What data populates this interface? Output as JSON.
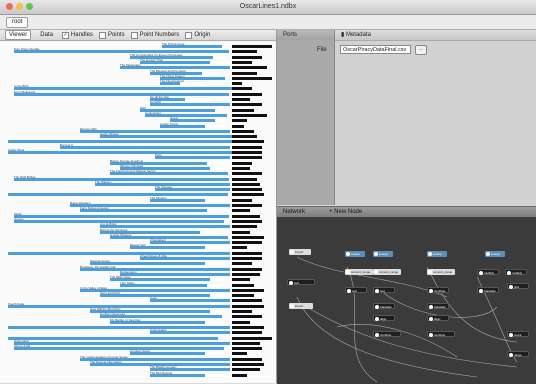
{
  "window": {
    "title": "OscarLines1.ndbx",
    "lights": [
      "#ec6a5e",
      "#f4bf4f",
      "#61c554"
    ]
  },
  "toolbar": {
    "button": "root"
  },
  "viewer": {
    "tabs": [
      "Viewer",
      "Data"
    ],
    "checks": [
      {
        "label": "Handles",
        "checked": true
      },
      {
        "label": "Points",
        "checked": false
      },
      {
        "label": "Point Numbers",
        "checked": false
      },
      {
        "label": "Origin",
        "checked": false
      }
    ],
    "rows": [
      {
        "label": "The Prince Kong",
        "bl": 162,
        "bw": 60,
        "ww": 0,
        "kw": 40
      },
      {
        "label": "Pom Poms Sunday",
        "bl": 14,
        "bw": 215,
        "ww": 0,
        "kw": 25
      },
      {
        "label": "The Complexities of Unseen Processes",
        "bl": 130,
        "bw": 95,
        "ww": 12,
        "kw": 30
      },
      {
        "label": "The Honest Thief",
        "bl": 140,
        "bw": 90,
        "ww": 20,
        "kw": 20
      },
      {
        "label": "The Messenger",
        "bl": 120,
        "bw": 110,
        "ww": 0,
        "kw": 35
      },
      {
        "label": "The Blessed and the Dead",
        "bl": 150,
        "bw": 70,
        "ww": 18,
        "kw": 25
      },
      {
        "label": "The Flying Dragon",
        "bl": 160,
        "bw": 65,
        "ww": 0,
        "kw": 40
      },
      {
        "label": "The Final Festival",
        "bl": 160,
        "bw": 45,
        "ww": 25,
        "kw": 10
      },
      {
        "label": "In the Birth",
        "bl": 14,
        "bw": 220,
        "ww": 0,
        "kw": 20
      },
      {
        "label": "Harry Bellefonte",
        "bl": 14,
        "bw": 215,
        "ww": 0,
        "kw": 30
      },
      {
        "label": "On all the Day",
        "bl": 150,
        "bw": 60,
        "ww": 25,
        "kw": 18
      },
      {
        "label": "Gentrific",
        "bl": 150,
        "bw": 80,
        "ww": 0,
        "kw": 30
      },
      {
        "label": "Well",
        "bl": 140,
        "bw": 75,
        "ww": 0,
        "kw": 22
      },
      {
        "label": "Conjunction",
        "bl": 145,
        "bw": 82,
        "ww": 0,
        "kw": 35
      },
      {
        "label": "Guest",
        "bl": 170,
        "bw": 55,
        "ww": 10,
        "kw": 15
      },
      {
        "label": "Lonely Towns",
        "bl": 160,
        "bw": 65,
        "ww": 20,
        "kw": 12
      },
      {
        "label": "Elusive Gifts",
        "bl": 80,
        "bw": 150,
        "ww": 0,
        "kw": 22
      },
      {
        "label": "Happy Bolivar",
        "bl": 100,
        "bw": 132,
        "ww": 0,
        "kw": 25
      },
      {
        "label": "",
        "bl": 8,
        "bw": 225,
        "ww": 0,
        "kw": 32
      },
      {
        "label": "Burning 9",
        "bl": 60,
        "bw": 170,
        "ww": 0,
        "kw": 30
      },
      {
        "label": "Inside Attica",
        "bl": 8,
        "bw": 225,
        "ww": 0,
        "kw": 30
      },
      {
        "label": "Paris",
        "bl": 155,
        "bw": 75,
        "ww": 0,
        "kw": 30
      },
      {
        "label": "Before Sunrise Amethyst",
        "bl": 110,
        "bw": 115,
        "ww": 18,
        "kw": 20
      },
      {
        "label": "Silence Unlimited",
        "bl": 120,
        "bw": 110,
        "ww": 20,
        "kw": 18
      },
      {
        "label": "The Fourth Kind of Darkest Secret",
        "bl": 110,
        "bw": 118,
        "ww": 0,
        "kw": 30
      },
      {
        "label": "The Wolf Bridge",
        "bl": 14,
        "bw": 215,
        "ww": 0,
        "kw": 25
      },
      {
        "label": "The Warden",
        "bl": 95,
        "bw": 135,
        "ww": 0,
        "kw": 28
      },
      {
        "label": "The Odyssey",
        "bl": 155,
        "bw": 75,
        "ww": 0,
        "kw": 30
      },
      {
        "label": "",
        "bl": 8,
        "bw": 220,
        "ww": 0,
        "kw": 32
      },
      {
        "label": "The Minstrel",
        "bl": 150,
        "bw": 75,
        "ww": 20,
        "kw": 20
      },
      {
        "label": "Bugsy Dandam",
        "bl": 70,
        "bw": 160,
        "ww": 0,
        "kw": 30
      },
      {
        "label": "Forty Sixties Ancestor",
        "bl": 80,
        "bw": 145,
        "ww": 18,
        "kw": 18
      },
      {
        "label": "Melior",
        "bl": 14,
        "bw": 215,
        "ww": 0,
        "kw": 28
      },
      {
        "label": "Joyous",
        "bl": 14,
        "bw": 210,
        "ww": 0,
        "kw": 30
      },
      {
        "label": "A to la Ricks",
        "bl": 100,
        "bw": 130,
        "ww": 0,
        "kw": 25
      },
      {
        "label": "Behind the Windows",
        "bl": 100,
        "bw": 120,
        "ww": 20,
        "kw": 18
      },
      {
        "label": "Amulet Wrapper",
        "bl": 110,
        "bw": 118,
        "ww": 0,
        "kw": 32
      },
      {
        "label": "Chandeliers",
        "bl": 150,
        "bw": 80,
        "ww": 0,
        "kw": 30
      },
      {
        "label": "Beaver Doll",
        "bl": 130,
        "bw": 95,
        "ww": 20,
        "kw": 15
      },
      {
        "label": "",
        "bl": 8,
        "bw": 222,
        "ww": 0,
        "kw": 30
      },
      {
        "label": "Cheerfulness & May",
        "bl": 140,
        "bw": 90,
        "ww": 0,
        "kw": 30
      },
      {
        "label": "Natural Hustler",
        "bl": 90,
        "bw": 135,
        "ww": 20,
        "kw": 20
      },
      {
        "label": "Broadway, the Garden Gal",
        "bl": 80,
        "bw": 150,
        "ww": 0,
        "kw": 30
      },
      {
        "label": "Reclamation",
        "bl": 120,
        "bw": 110,
        "ww": 0,
        "kw": 28
      },
      {
        "label": "The Bidle Case",
        "bl": 110,
        "bw": 115,
        "ww": 15,
        "kw": 18
      },
      {
        "label": "I Am Sham",
        "bl": 120,
        "bw": 105,
        "ww": 18,
        "kw": 22
      },
      {
        "label": "In the Valley of Elam",
        "bl": 80,
        "bw": 150,
        "ww": 0,
        "kw": 32
      },
      {
        "label": "Sons and Echo",
        "bl": 100,
        "bw": 125,
        "ww": 15,
        "kw": 22
      },
      {
        "label": "Gave",
        "bl": 150,
        "bw": 80,
        "ww": 0,
        "kw": 30
      },
      {
        "label": "Fourth Fade",
        "bl": 8,
        "bw": 222,
        "ww": 0,
        "kw": 32
      },
      {
        "label": "Give Will the Best Duty",
        "bl": 90,
        "bw": 135,
        "ww": 15,
        "kw": 20
      },
      {
        "label": "Northern Exposure",
        "bl": 100,
        "bw": 122,
        "ww": 0,
        "kw": 30
      },
      {
        "label": "My Mantle, In Few Day",
        "bl": 110,
        "bw": 115,
        "ww": 20,
        "kw": 18
      },
      {
        "label": "",
        "bl": 8,
        "bw": 222,
        "ww": 0,
        "kw": 32
      },
      {
        "label": "Unknowable",
        "bl": 150,
        "bw": 80,
        "ww": 0,
        "kw": 30
      },
      {
        "label": "",
        "bl": 8,
        "bw": 210,
        "ww": 0,
        "kw": 40
      },
      {
        "label": "Hibernation",
        "bl": 14,
        "bw": 216,
        "ww": 0,
        "kw": 28
      },
      {
        "label": "Above & Me",
        "bl": 14,
        "bw": 210,
        "ww": 0,
        "kw": 30
      },
      {
        "label": "Humbert Road",
        "bl": 130,
        "bw": 95,
        "ww": 20,
        "kw": 15
      },
      {
        "label": "The Implementation of Lunar Sense",
        "bl": 80,
        "bw": 150,
        "ww": 0,
        "kw": 30
      },
      {
        "label": "The Dasyna Attenuation",
        "bl": 90,
        "bw": 140,
        "ww": 0,
        "kw": 32
      },
      {
        "label": "The Bridal Compact",
        "bl": 150,
        "bw": 80,
        "ww": 0,
        "kw": 28
      },
      {
        "label": "The Bird Rescue",
        "bl": 150,
        "bw": 75,
        "ww": 20,
        "kw": 15
      }
    ]
  },
  "ports": {
    "title": "Ports"
  },
  "metadata": {
    "title": "Metadata",
    "file_label": "File",
    "file_value": "OscarPiracyDataFinal.csv",
    "browse_label": "..."
  },
  "network": {
    "title": "Network",
    "new_node": "+ New Node",
    "nodes": [
      {
        "label": "import",
        "style": "light"
      },
      {
        "label": "import",
        "style": "light"
      },
      {
        "label": "lookup",
        "style": "blue"
      },
      {
        "label": "lookup",
        "style": "blue"
      },
      {
        "label": "lookup",
        "style": "blue"
      },
      {
        "label": "lookup",
        "style": "blue"
      },
      {
        "label": "convert_range",
        "style": "light"
      },
      {
        "label": "convert_range",
        "style": "light"
      },
      {
        "label": "convert_range",
        "style": "light"
      },
      {
        "label": "multiply",
        "style": "dark"
      },
      {
        "label": "multiply",
        "style": "dark"
      },
      {
        "label": "rect",
        "style": "dark"
      },
      {
        "label": "rect",
        "style": "dark"
      },
      {
        "label": "text",
        "style": "dark"
      },
      {
        "label": "combine",
        "style": "dark"
      },
      {
        "label": "translate",
        "style": "dark"
      },
      {
        "label": "translate",
        "style": "dark"
      },
      {
        "label": "translate",
        "style": "dark"
      },
      {
        "label": "align",
        "style": "dark"
      },
      {
        "label": "align",
        "style": "dark"
      },
      {
        "label": "combine",
        "style": "dark"
      },
      {
        "label": "combine",
        "style": "dark"
      },
      {
        "label": "grid",
        "style": "dark"
      },
      {
        "label": "count",
        "style": "dark"
      },
      {
        "label": "range",
        "style": "dark"
      }
    ]
  }
}
